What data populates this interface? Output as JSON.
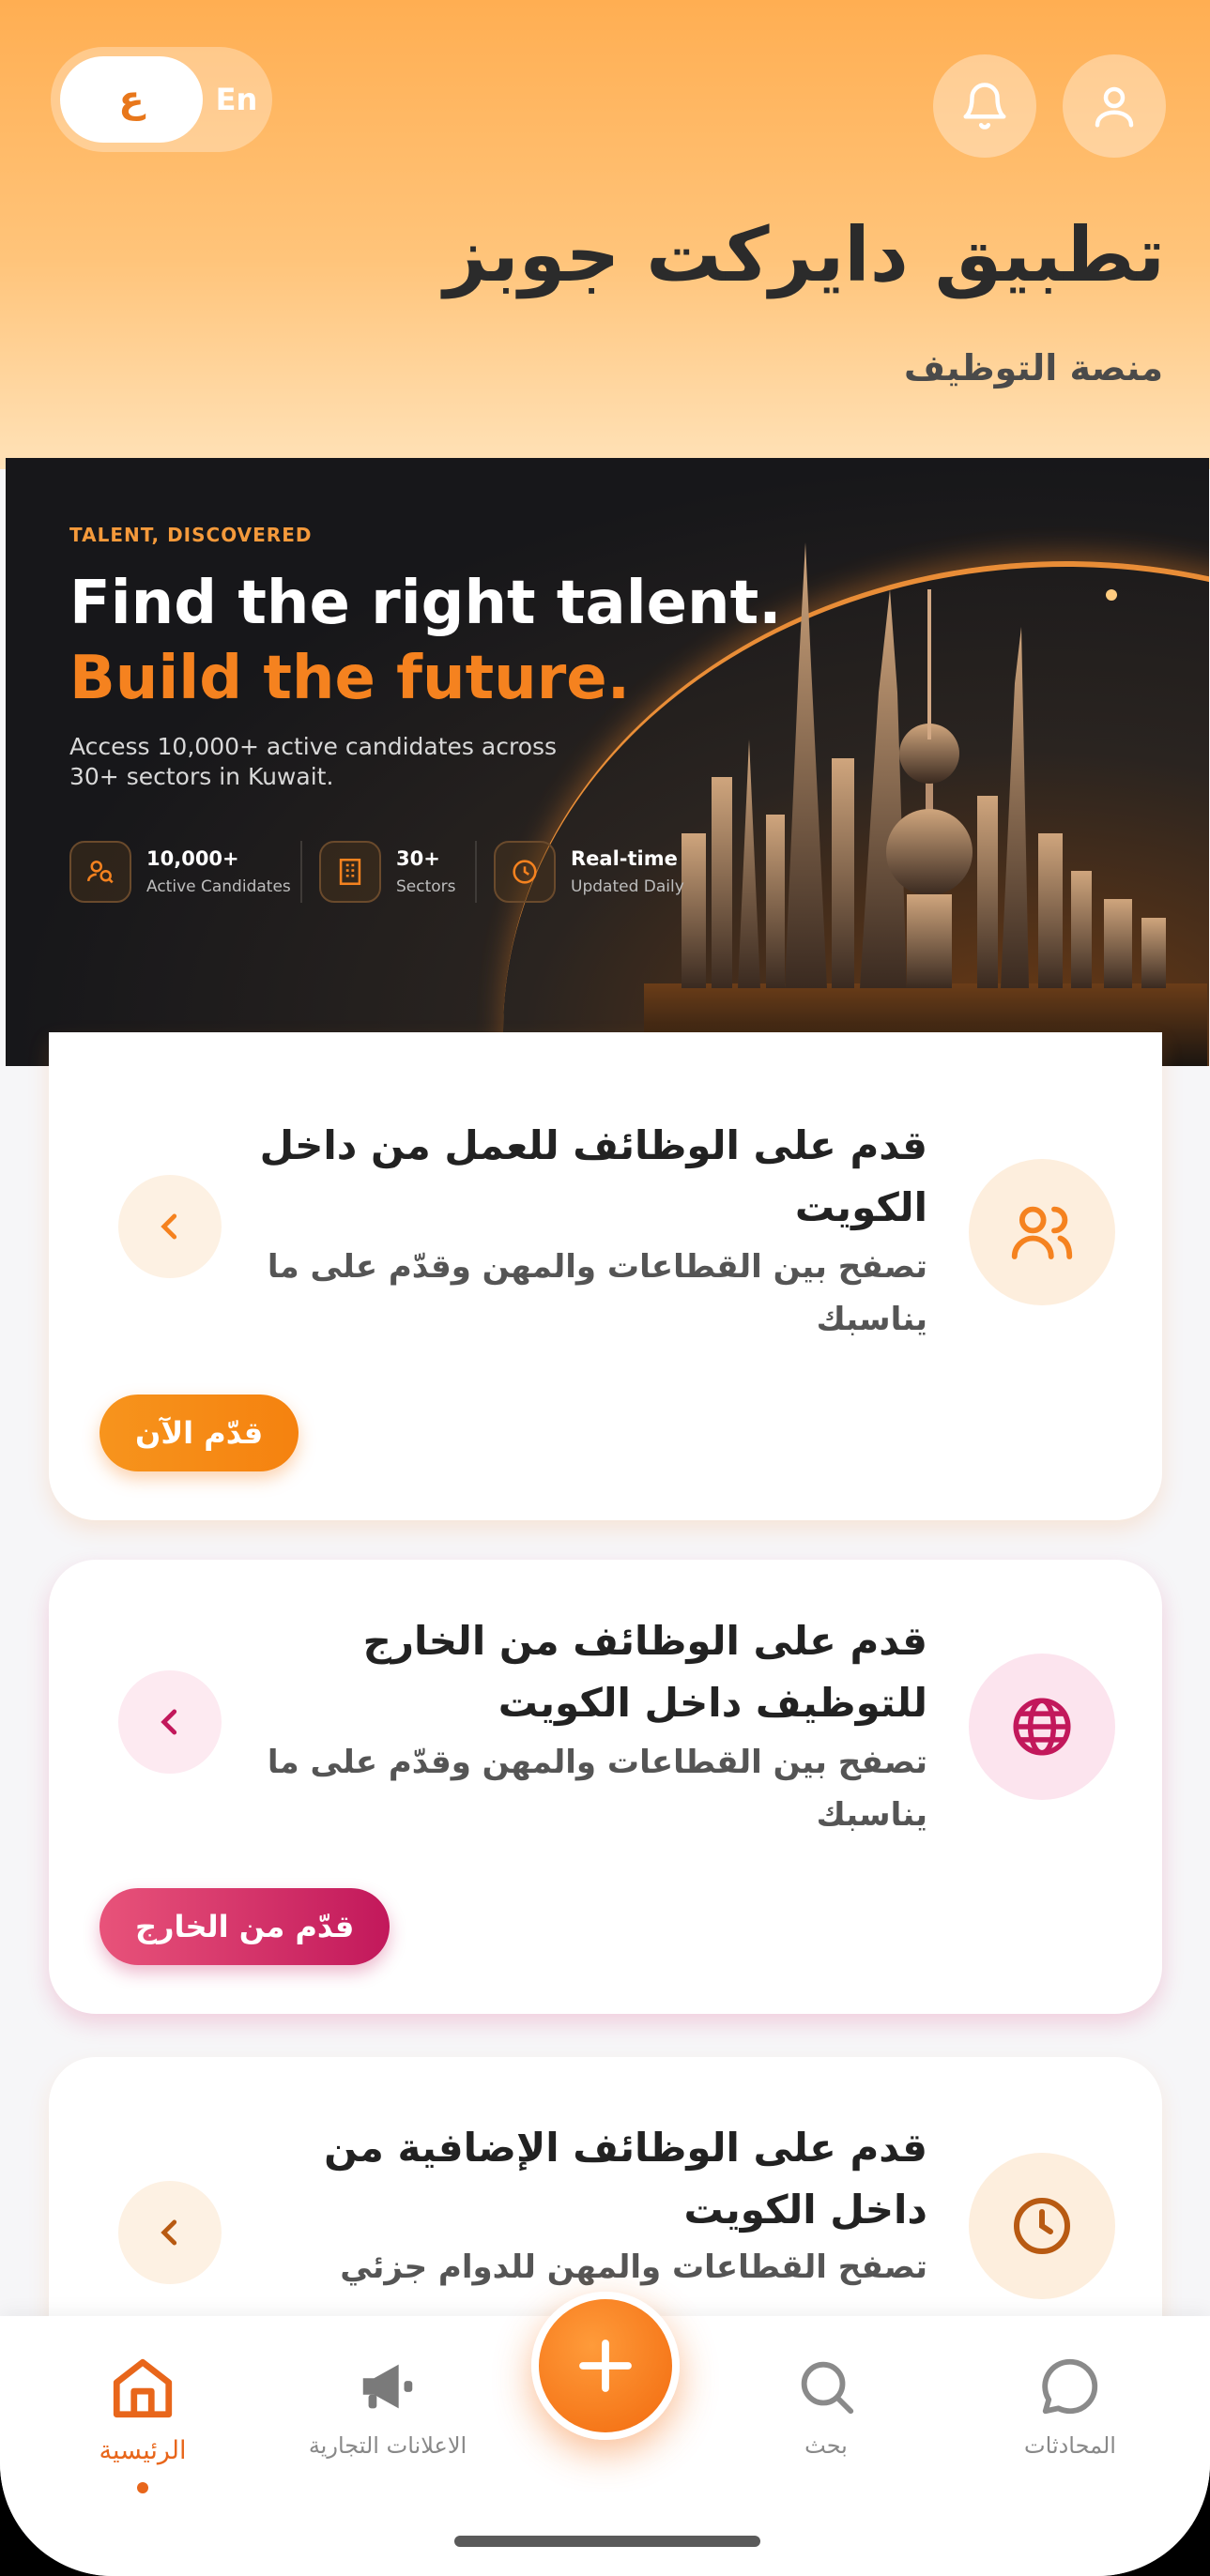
{
  "header": {
    "lang_ar": "ع",
    "lang_en": "En",
    "title": "تطبيق دايركت جوبز",
    "subtitle": "منصة التوظيف"
  },
  "hero": {
    "eyebrow": "TALENT, DISCOVERED",
    "headline_1": "Find the right talent.",
    "headline_2": "Build the future.",
    "description": "Access 10,000+ active candidates across 30+ sectors in Kuwait.",
    "stats": [
      {
        "value": "10,000+",
        "label": "Active Candidates",
        "icon": "users-search-icon"
      },
      {
        "value": "30+",
        "label": "Sectors",
        "icon": "building-icon"
      },
      {
        "value": "Real-time",
        "label": "Updated Daily",
        "icon": "clock-refresh-icon"
      }
    ],
    "accent": "#f5821f"
  },
  "carousel": {
    "active_index": 0,
    "total": 2
  },
  "cards": [
    {
      "title": "قدم على الوظائف للعمل من داخل الكويت",
      "description": "تصفح بين القطاعات والمهن وقدّم على ما يناسبك",
      "button": "قدّم الآن",
      "icon": "users-icon",
      "accent": "#f5821f"
    },
    {
      "title": "قدم على الوظائف من الخارج للتوظيف داخل الكويت",
      "description": "تصفح بين القطاعات والمهن وقدّم على ما يناسبك",
      "button": "قدّم من الخارج",
      "icon": "globe-icon",
      "accent": "#c2185b"
    },
    {
      "title": "قدم على الوظائف الإضافية من داخل الكويت",
      "description": "تصفح القطاعات والمهن للدوام جزئي",
      "icon": "clock-icon",
      "accent": "#b85a12"
    }
  ],
  "nav": {
    "home": "الرئيسية",
    "ads": "الاعلانات التجارية",
    "search": "بحث",
    "chats": "المحادثات",
    "active": "home"
  }
}
